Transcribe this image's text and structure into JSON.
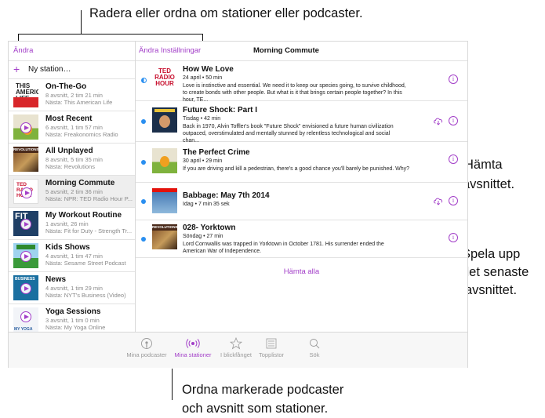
{
  "callouts": {
    "top": "Radera eller ordna om stationer eller podcaster.",
    "hamta_1": "Hämta",
    "hamta_2": "avsnittet.",
    "spela_1": "Spela upp",
    "spela_2": "det senaste",
    "spela_3": "avsnittet.",
    "ordna_1": "Ordna markerade podcaster",
    "ordna_2": "och avsnitt som stationer."
  },
  "sidebar": {
    "edit_label": "Ändra",
    "new_station_label": "Ny station…",
    "stations": [
      {
        "title": "On-The-Go",
        "line1": "8 avsnitt, 2 tim 21 min",
        "line2": "Nästa: This American Life",
        "art": "this-american-life"
      },
      {
        "title": "Most Recent",
        "line1": "6 avsnitt, 1 tim 57 min",
        "line2": "Nästa: Freakonomics Radio",
        "art": "freakonomics"
      },
      {
        "title": "All Unplayed",
        "line1": "8 avsnitt, 5 tim 35 min",
        "line2": "Nästa: Revolutions",
        "art": "revolutions"
      },
      {
        "title": "Morning Commute",
        "line1": "5 avsnitt, 2 tim 36 min",
        "line2": "Nästa: NPR: TED Radio Hour P...",
        "art": "ted",
        "selected": true
      },
      {
        "title": "My Workout Routine",
        "line1": "1 avsnitt, 26 min",
        "line2": "Nästa: Fit for Duty - Strength Tr...",
        "art": "fit"
      },
      {
        "title": "Kids Shows",
        "line1": "4 avsnitt, 1 tim 47 min",
        "line2": "Nästa: Sesame Street Podcast",
        "art": "sesame"
      },
      {
        "title": "News",
        "line1": "4 avsnitt, 1 tim 29 min",
        "line2": "Nästa: NYT's Business (Video)",
        "art": "business"
      },
      {
        "title": "Yoga Sessions",
        "line1": "3 avsnitt, 1 tim 0 min",
        "line2": "Nästa: My Yoga Online",
        "art": "yoga"
      }
    ]
  },
  "main": {
    "edit_label": "Ändra Inställningar",
    "title": "Morning Commute",
    "get_all_label": "Hämta alla",
    "episodes": [
      {
        "title": "How We Love",
        "meta": "24 april • 50 min",
        "desc": "Love is instinctive and essential. We need it to keep our species going, to survive childhood, to create bonds with other people. But what is it that brings certain people together? In this hour, TE...",
        "status": "half",
        "cloud": false
      },
      {
        "title": "Future Shock: Part I",
        "meta": "Tisdag • 42 min",
        "desc": "Back in 1970, Alvin Toffler's book \"Future Shock\" envisioned a future human civilization outpaced, overstimulated and mentally stunned by relentless technological and social chan...",
        "status": "dot",
        "cloud": true
      },
      {
        "title": "The Perfect Crime",
        "meta": "30 april • 29 min",
        "desc": "If you are driving and kill a pedestrian, there's a good chance you'll barely be punished. Why?",
        "status": "dot",
        "cloud": false
      },
      {
        "title": "Babbage: May 7th 2014",
        "meta": "Idag • 7 min 35 sek",
        "desc": "",
        "status": "dot",
        "cloud": true
      },
      {
        "title": "028- Yorktown",
        "meta": "Söndag • 27 min",
        "desc": "Lord Cornwallis was trapped in Yorktown in October 1781. His surrender ended the American War of Independence.",
        "status": "dot",
        "cloud": false
      }
    ]
  },
  "tabbar": {
    "tabs": [
      {
        "label": "Mina podcaster",
        "icon": "podcast-icon"
      },
      {
        "label": "Mina stationer",
        "icon": "stations-icon",
        "active": true
      },
      {
        "label": "I blickfånget",
        "icon": "star-icon"
      },
      {
        "label": "Topplistor",
        "icon": "list-icon"
      },
      {
        "label": "Sök",
        "icon": "search-icon"
      }
    ]
  },
  "thumb_texts": {
    "this_american_life": "THIS AMERICAN LIFE",
    "revolutions": "REVOLUTIONS",
    "ted": "TED RADIO HOUR",
    "fit": "FIT",
    "business": "BUSINESS",
    "yoga": "MY YOGA"
  },
  "colors": {
    "accent": "#a23ec8",
    "unplayed": "#2a8ff0"
  }
}
